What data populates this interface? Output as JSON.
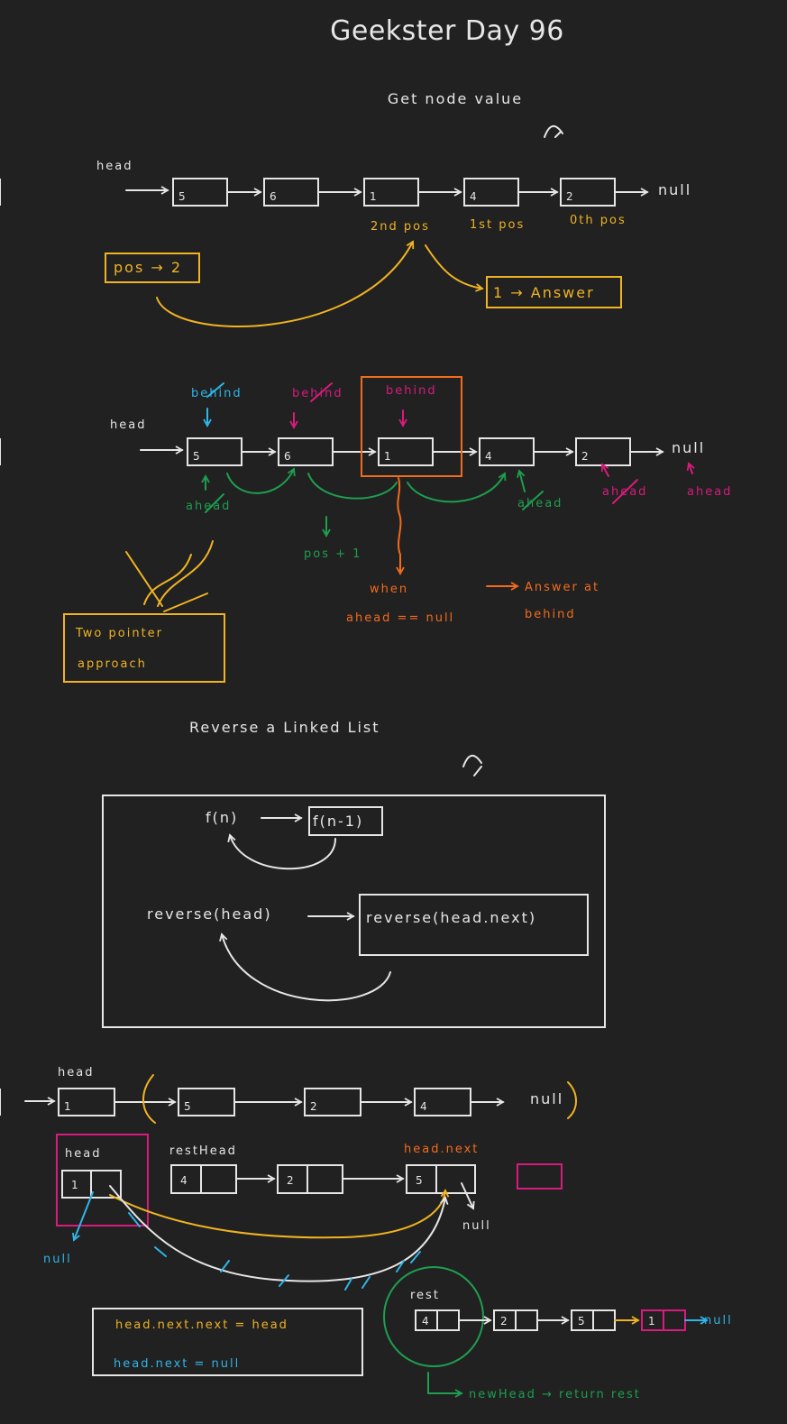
{
  "title": "Geekster Day 96",
  "section1": {
    "heading": "Get node value",
    "head_label": "head",
    "list": [
      "5",
      "6",
      "1",
      "4",
      "2"
    ],
    "null_label": "null",
    "pos_labels": [
      "2nd pos",
      "1st pos",
      "0th pos"
    ],
    "pos_box": "pos → 2",
    "answer_box": "1 → Answer"
  },
  "section2": {
    "head_label": "head",
    "list": [
      "5",
      "6",
      "1",
      "4",
      "2"
    ],
    "null_label": "null",
    "behind_labels": [
      "behind",
      "behind",
      "behind"
    ],
    "ahead_labels": [
      "ahead",
      "ahead",
      "ahead",
      "ahead"
    ],
    "pos_plus": "pos + 1",
    "when_label": "when",
    "condition": "ahead == null",
    "answer_note": "Answer at behind",
    "two_pointer": "Two pointer approach"
  },
  "section3": {
    "heading": "Reverse a Linked List",
    "fn": "f(n)",
    "fn_minus": "f(n-1)",
    "reverse_head": "reverse(head)",
    "reverse_next": "reverse(head.next)"
  },
  "section4": {
    "head_label": "head",
    "list": [
      "1",
      "5",
      "2",
      "4"
    ],
    "null_label": "null",
    "head_box_label": "head",
    "head_node": "1",
    "rest_head_label": "restHead",
    "rest_list": [
      "4",
      "2",
      "5"
    ],
    "head_next_label": "head.next",
    "null_small": "null",
    "null_blue": "null",
    "code_line1": "head.next.next = head",
    "code_line2": "head.next = null",
    "rest_label": "rest",
    "final_list": [
      "4",
      "2",
      "5",
      "1"
    ],
    "final_null": "null",
    "new_head_note": "newHead → return rest"
  },
  "colors": {
    "background": "#212121",
    "ink": "#e6e6e6",
    "orange": "#f0b323",
    "blue": "#2fb5e8",
    "pink": "#d81b7c",
    "green": "#1e9e4f",
    "red_orange": "#f26b1d"
  }
}
